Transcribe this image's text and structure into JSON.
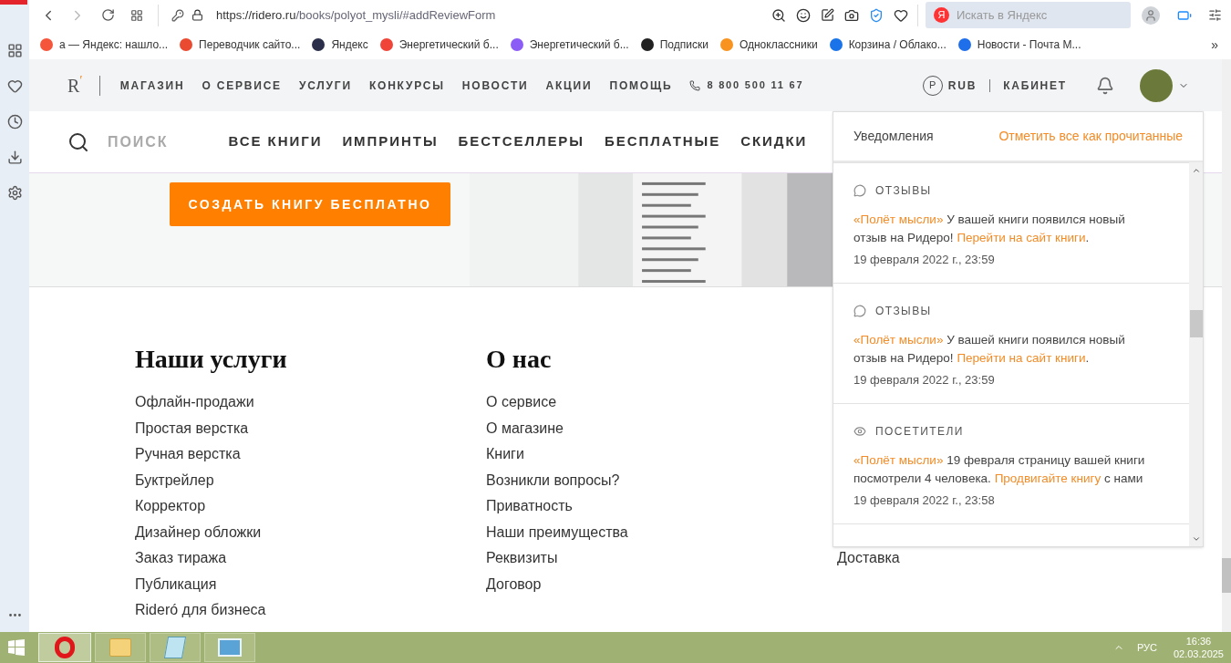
{
  "browser": {
    "url_host": "https://ridero.ru",
    "url_path": "/books/polyot_mysli/#addReviewForm",
    "search_placeholder": "Искать в Яндекс",
    "search_logo": "Я",
    "bookmarks": [
      {
        "label": "а — Яндекс: нашло...",
        "color": "#f5553b"
      },
      {
        "label": "Переводчик сайто...",
        "color": "#ea4a2f"
      },
      {
        "label": "Яндекс",
        "color": "#2b2f4a"
      },
      {
        "label": "Энергетический б...",
        "color": "#f04438"
      },
      {
        "label": "Энергетический б...",
        "color": "#8b5cf6"
      },
      {
        "label": "Подписки",
        "color": "#222222"
      },
      {
        "label": "Одноклассники",
        "color": "#f7931e"
      },
      {
        "label": "Корзина / Облако...",
        "color": "#1a73e8"
      },
      {
        "label": "Новости - Почта М...",
        "color": "#1f6feb"
      }
    ],
    "more": "»"
  },
  "site": {
    "logo": "R",
    "logo_accent": "′",
    "top_nav": [
      "МАГАЗИН",
      "О СЕРВИСЕ",
      "УСЛУГИ",
      "КОНКУРСЫ",
      "НОВОСТИ",
      "АКЦИИ",
      "ПОМОЩЬ"
    ],
    "phone": "8 800 500 11 67",
    "currency_symbol": "P",
    "currency": "RUB",
    "cabinet": "КАБИНЕТ",
    "search_label": "ПОИСК",
    "catalog_nav": [
      "ВСЕ КНИГИ",
      "ИМПРИНТЫ",
      "БЕСТСЕЛЛЕРЫ",
      "БЕСПЛАТНЫЕ",
      "СКИДКИ"
    ],
    "cta": "СОЗДАТЬ КНИГУ БЕСПЛАТНО",
    "footer_columns": [
      {
        "title": "Наши услуги",
        "links": [
          "Офлайн-продажи",
          "Простая верстка",
          "Ручная верстка",
          "Буктрейлер",
          "Корректор",
          "Дизайнер обложки",
          "Заказ тиража",
          "Публикация",
          "Rideró для бизнеса"
        ]
      },
      {
        "title": "О нас",
        "links": [
          "О сервисе",
          "О магазине",
          "Книги",
          "Возникли вопросы?",
          "Приватность",
          "Наши преимущества",
          "Реквизиты",
          "Договор"
        ]
      },
      {
        "links": [
          "Доставка"
        ]
      }
    ]
  },
  "notifications": {
    "title": "Уведомления",
    "mark_all": "Отметить все как прочитанные",
    "items": [
      {
        "kind": "comment",
        "category": "ОТЗЫВЫ",
        "parts": [
          {
            "text": "«Полёт мысли»",
            "link": true
          },
          {
            "text": " У вашей книги появился новый отзыв на Ридеро! ",
            "link": false
          },
          {
            "text": "Перейти на сайт книги",
            "link": true
          },
          {
            "text": ".",
            "link": false
          }
        ],
        "date": "19 февраля 2022 г., 23:59"
      },
      {
        "kind": "comment",
        "category": "ОТЗЫВЫ",
        "parts": [
          {
            "text": "«Полёт мысли»",
            "link": true
          },
          {
            "text": " У вашей книги появился новый отзыв на Ридеро! ",
            "link": false
          },
          {
            "text": "Перейти на сайт книги",
            "link": true
          },
          {
            "text": ".",
            "link": false
          }
        ],
        "date": "19 февраля 2022 г., 23:59"
      },
      {
        "kind": "eye",
        "category": "ПОСЕТИТЕЛИ",
        "parts": [
          {
            "text": "«Полёт мысли»",
            "link": true
          },
          {
            "text": " 19 февраля страницу вашей книги посмотрели 4 человека. ",
            "link": false
          },
          {
            "text": "Продвигайте книгу",
            "link": true
          },
          {
            "text": " с нами",
            "link": false
          }
        ],
        "date": "19 февраля 2022 г., 23:58"
      }
    ]
  },
  "taskbar": {
    "language": "РУС",
    "time": "16:36",
    "date": "02.03.2025"
  }
}
